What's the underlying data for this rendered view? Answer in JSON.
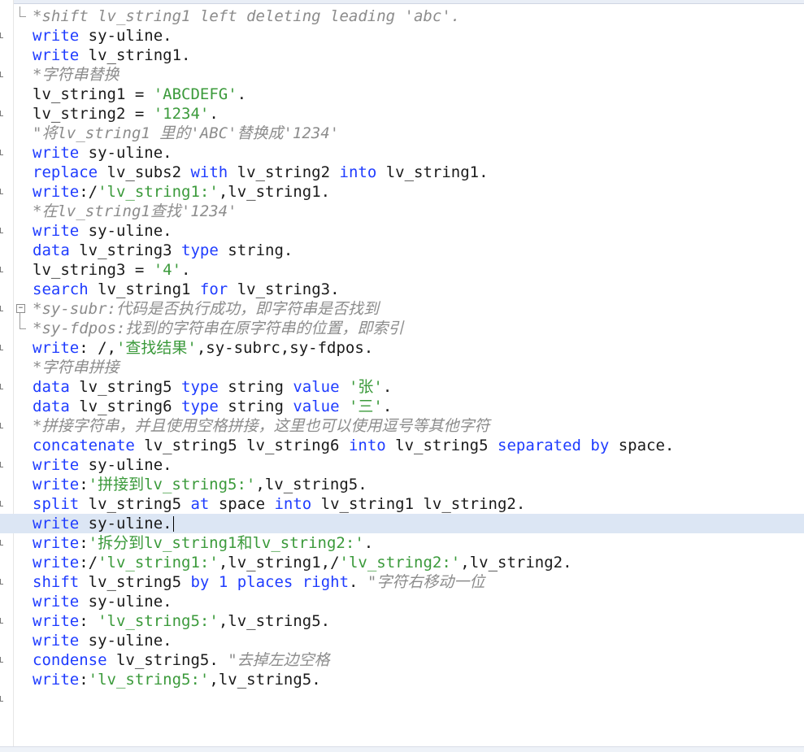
{
  "editor": {
    "current_line_index": 26,
    "lines": [
      {
        "tokens": [
          {
            "t": "*shift lv_string1 left deleting leading 'abc'.",
            "c": "cmt"
          }
        ]
      },
      {
        "tokens": [
          {
            "t": "write",
            "c": "kw"
          },
          {
            "t": " sy-uline.",
            "c": ""
          }
        ]
      },
      {
        "tokens": [
          {
            "t": "write",
            "c": "kw"
          },
          {
            "t": " lv_string1.",
            "c": ""
          }
        ]
      },
      {
        "tokens": [
          {
            "t": "*字符串替换",
            "c": "cmt"
          }
        ]
      },
      {
        "tokens": [
          {
            "t": "lv_string1 = ",
            "c": ""
          },
          {
            "t": "'ABCDEFG'",
            "c": "str"
          },
          {
            "t": ".",
            "c": ""
          }
        ]
      },
      {
        "tokens": [
          {
            "t": "lv_string2 = ",
            "c": ""
          },
          {
            "t": "'1234'",
            "c": "str"
          },
          {
            "t": ".",
            "c": ""
          }
        ]
      },
      {
        "tokens": [
          {
            "t": "\"将lv_string1 里的'ABC'替换成'1234'",
            "c": "cmt"
          }
        ]
      },
      {
        "tokens": [
          {
            "t": "write",
            "c": "kw"
          },
          {
            "t": " sy-uline.",
            "c": ""
          }
        ]
      },
      {
        "tokens": [
          {
            "t": "replace",
            "c": "kw"
          },
          {
            "t": " lv_subs2 ",
            "c": ""
          },
          {
            "t": "with",
            "c": "kw"
          },
          {
            "t": " lv_string2 ",
            "c": ""
          },
          {
            "t": "into",
            "c": "kw"
          },
          {
            "t": " lv_string1.",
            "c": ""
          }
        ]
      },
      {
        "tokens": [
          {
            "t": "write",
            "c": "kw"
          },
          {
            "t": ":/",
            "c": ""
          },
          {
            "t": "'lv_string1:'",
            "c": "str"
          },
          {
            "t": ",lv_string1.",
            "c": ""
          }
        ]
      },
      {
        "tokens": [
          {
            "t": "*在lv_string1查找'1234'",
            "c": "cmt"
          }
        ]
      },
      {
        "tokens": [
          {
            "t": "write",
            "c": "kw"
          },
          {
            "t": " sy-uline.",
            "c": ""
          }
        ]
      },
      {
        "tokens": [
          {
            "t": "data",
            "c": "kw"
          },
          {
            "t": " lv_string3 ",
            "c": ""
          },
          {
            "t": "type",
            "c": "kw"
          },
          {
            "t": " string.",
            "c": ""
          }
        ]
      },
      {
        "tokens": [
          {
            "t": "lv_string3 = ",
            "c": ""
          },
          {
            "t": "'4'",
            "c": "str"
          },
          {
            "t": ".",
            "c": ""
          }
        ]
      },
      {
        "tokens": [
          {
            "t": "search",
            "c": "kw"
          },
          {
            "t": " lv_string1 ",
            "c": ""
          },
          {
            "t": "for",
            "c": "kw"
          },
          {
            "t": " lv_string3.",
            "c": ""
          }
        ]
      },
      {
        "tokens": [
          {
            "t": "*sy-subr:代码是否执行成功，即字符串是否找到",
            "c": "cmt"
          }
        ]
      },
      {
        "tokens": [
          {
            "t": "*sy-fdpos:找到的字符串在原字符串的位置，即索引",
            "c": "cmt"
          }
        ]
      },
      {
        "tokens": [
          {
            "t": "write",
            "c": "kw"
          },
          {
            "t": ": /,",
            "c": ""
          },
          {
            "t": "'查找结果'",
            "c": "str"
          },
          {
            "t": ",sy-subrc,sy-fdpos.",
            "c": ""
          }
        ]
      },
      {
        "tokens": [
          {
            "t": "*字符串拼接",
            "c": "cmt"
          }
        ]
      },
      {
        "tokens": [
          {
            "t": "data",
            "c": "kw"
          },
          {
            "t": " lv_string5 ",
            "c": ""
          },
          {
            "t": "type",
            "c": "kw"
          },
          {
            "t": " string ",
            "c": ""
          },
          {
            "t": "value",
            "c": "kw"
          },
          {
            "t": " ",
            "c": ""
          },
          {
            "t": "'张'",
            "c": "str"
          },
          {
            "t": ".",
            "c": ""
          }
        ]
      },
      {
        "tokens": [
          {
            "t": "data",
            "c": "kw"
          },
          {
            "t": " lv_string6 ",
            "c": ""
          },
          {
            "t": "type",
            "c": "kw"
          },
          {
            "t": " string ",
            "c": ""
          },
          {
            "t": "value",
            "c": "kw"
          },
          {
            "t": " ",
            "c": ""
          },
          {
            "t": "'三'",
            "c": "str"
          },
          {
            "t": ".",
            "c": ""
          }
        ]
      },
      {
        "tokens": [
          {
            "t": "*拼接字符串，并且使用空格拼接，这里也可以使用逗号等其他字符",
            "c": "cmt"
          }
        ]
      },
      {
        "tokens": [
          {
            "t": "concatenate",
            "c": "kw"
          },
          {
            "t": " lv_string5 lv_string6 ",
            "c": ""
          },
          {
            "t": "into",
            "c": "kw"
          },
          {
            "t": " lv_string5 ",
            "c": ""
          },
          {
            "t": "separated by",
            "c": "kw"
          },
          {
            "t": " space.",
            "c": ""
          }
        ]
      },
      {
        "tokens": [
          {
            "t": "write",
            "c": "kw"
          },
          {
            "t": " sy-uline.",
            "c": ""
          }
        ]
      },
      {
        "tokens": [
          {
            "t": "write",
            "c": "kw"
          },
          {
            "t": ":",
            "c": ""
          },
          {
            "t": "'拼接到lv_string5:'",
            "c": "str"
          },
          {
            "t": ",lv_string5.",
            "c": ""
          }
        ]
      },
      {
        "tokens": [
          {
            "t": "split",
            "c": "kw"
          },
          {
            "t": " lv_string5 ",
            "c": ""
          },
          {
            "t": "at",
            "c": "kw"
          },
          {
            "t": " space ",
            "c": ""
          },
          {
            "t": "into",
            "c": "kw"
          },
          {
            "t": " lv_string1 lv_string2.",
            "c": ""
          }
        ]
      },
      {
        "tokens": [
          {
            "t": "write",
            "c": "kw"
          },
          {
            "t": " sy-uline.",
            "c": ""
          }
        ]
      },
      {
        "tokens": [
          {
            "t": "write",
            "c": "kw"
          },
          {
            "t": ":",
            "c": ""
          },
          {
            "t": "'拆分到lv_string1和lv_string2:'",
            "c": "str"
          },
          {
            "t": ".",
            "c": ""
          }
        ]
      },
      {
        "tokens": [
          {
            "t": "write",
            "c": "kw"
          },
          {
            "t": ":/",
            "c": ""
          },
          {
            "t": "'lv_string1:'",
            "c": "str"
          },
          {
            "t": ",lv_string1,/",
            "c": ""
          },
          {
            "t": "'lv_string2:'",
            "c": "str"
          },
          {
            "t": ",lv_string2.",
            "c": ""
          }
        ]
      },
      {
        "tokens": [
          {
            "t": "shift",
            "c": "kw"
          },
          {
            "t": " lv_string5 ",
            "c": ""
          },
          {
            "t": "by",
            "c": "kw"
          },
          {
            "t": " ",
            "c": ""
          },
          {
            "t": "1",
            "c": "num"
          },
          {
            "t": " ",
            "c": ""
          },
          {
            "t": "places",
            "c": "kw"
          },
          {
            "t": " ",
            "c": ""
          },
          {
            "t": "right",
            "c": "kw"
          },
          {
            "t": ". ",
            "c": ""
          },
          {
            "t": "\"字符右移动一位",
            "c": "cmt"
          }
        ]
      },
      {
        "tokens": [
          {
            "t": "write",
            "c": "kw"
          },
          {
            "t": " sy-uline.",
            "c": ""
          }
        ]
      },
      {
        "tokens": [
          {
            "t": "write",
            "c": "kw"
          },
          {
            "t": ": ",
            "c": ""
          },
          {
            "t": "'lv_string5:'",
            "c": "str"
          },
          {
            "t": ",lv_string5.",
            "c": ""
          }
        ]
      },
      {
        "tokens": [
          {
            "t": "write",
            "c": "kw"
          },
          {
            "t": " sy-uline.",
            "c": ""
          }
        ]
      },
      {
        "tokens": [
          {
            "t": "condense",
            "c": "kw"
          },
          {
            "t": " lv_string5. ",
            "c": ""
          },
          {
            "t": "\"去掉左边空格",
            "c": "cmt"
          }
        ]
      },
      {
        "tokens": [
          {
            "t": "write",
            "c": "kw"
          },
          {
            "t": ":",
            "c": ""
          },
          {
            "t": "'lv_string5:'",
            "c": "str"
          },
          {
            "t": ",lv_string5.",
            "c": ""
          }
        ]
      }
    ]
  }
}
